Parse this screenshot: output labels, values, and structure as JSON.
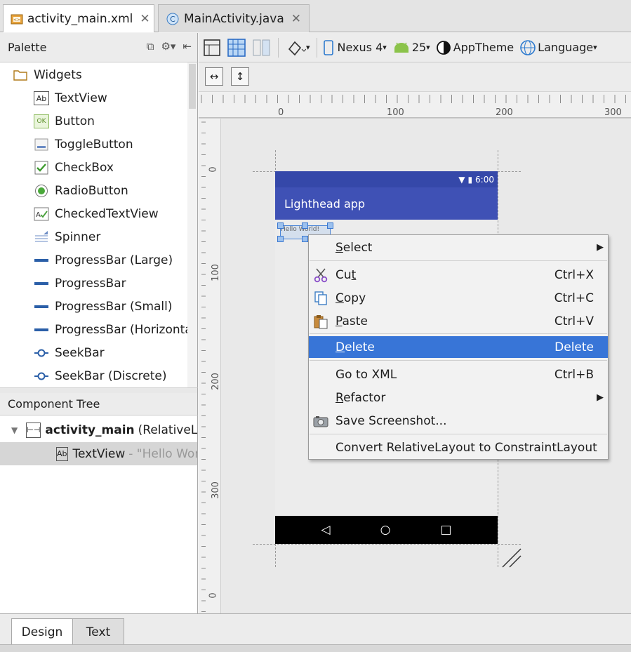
{
  "editor_tabs": [
    {
      "label": "activity_main.xml",
      "icon": "xml-file-icon",
      "active": true
    },
    {
      "label": "MainActivity.java",
      "icon": "java-class-icon",
      "active": false
    }
  ],
  "palette": {
    "title": "Palette",
    "category": "Widgets",
    "items": [
      "TextView",
      "Button",
      "ToggleButton",
      "CheckBox",
      "RadioButton",
      "CheckedTextView",
      "Spinner",
      "ProgressBar (Large)",
      "ProgressBar",
      "ProgressBar (Small)",
      "ProgressBar (Horizontal)",
      "SeekBar",
      "SeekBar (Discrete)"
    ]
  },
  "component_tree": {
    "title": "Component Tree",
    "root": {
      "name": "activity_main",
      "type": "(RelativeLayout)"
    },
    "child": {
      "name": "TextView",
      "value": "- \"Hello World!\""
    }
  },
  "toolbar": {
    "device": "Nexus 4",
    "api": "25",
    "theme": "AppTheme",
    "language": "Language"
  },
  "rulers": {
    "horizontal": [
      "0",
      "100",
      "200",
      "300"
    ],
    "vertical": [
      "0",
      "100",
      "200",
      "300",
      "0"
    ]
  },
  "device_preview": {
    "status_time": "6:00",
    "app_title": "Lighthead app",
    "textview_text": "Hello World!"
  },
  "context_menu": {
    "items": [
      {
        "label": "Select",
        "submenu": true
      },
      {
        "label": "Cut",
        "shortcut": "Ctrl+X",
        "icon": "scissors-icon"
      },
      {
        "label": "Copy",
        "shortcut": "Ctrl+C",
        "icon": "copy-icon"
      },
      {
        "label": "Paste",
        "shortcut": "Ctrl+V",
        "icon": "paste-icon"
      },
      {
        "label": "Delete",
        "shortcut": "Delete",
        "highlighted": true
      },
      {
        "label": "Go to XML",
        "shortcut": "Ctrl+B"
      },
      {
        "label": "Refactor",
        "submenu": true
      },
      {
        "label": "Save Screenshot...",
        "icon": "camera-icon"
      },
      {
        "label": "Convert RelativeLayout to ConstraintLayout"
      }
    ]
  },
  "bottom_tabs": [
    {
      "label": "Design",
      "active": true
    },
    {
      "label": "Text",
      "active": false
    }
  ],
  "colors": {
    "accent": "#3875d7",
    "app_bar": "#3f51b5",
    "status_bar": "#3548a9"
  }
}
